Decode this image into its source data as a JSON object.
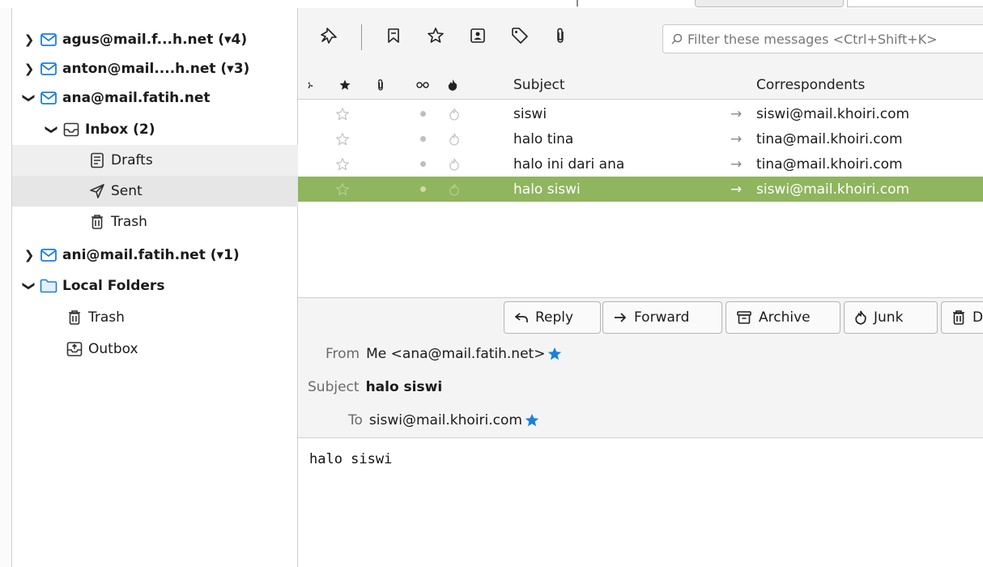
{
  "folders": {
    "acct1": {
      "label": "agus@mail.f...h.net (▾4)"
    },
    "acct2": {
      "label": "anton@mail....h.net (▾3)"
    },
    "acct3": {
      "label": "ana@mail.fatih.net"
    },
    "inbox": {
      "label": "Inbox (2)"
    },
    "drafts": {
      "label": "Drafts"
    },
    "sent": {
      "label": "Sent"
    },
    "trash": {
      "label": "Trash"
    },
    "acct4": {
      "label": "ani@mail.fatih.net (▾1)"
    },
    "local": {
      "label": "Local Folders"
    },
    "local_trash": {
      "label": "Trash"
    },
    "outbox": {
      "label": "Outbox"
    }
  },
  "filter": {
    "placeholder": "Filter these messages <Ctrl+Shift+K>"
  },
  "columns": {
    "subject": "Subject",
    "correspondents": "Correspondents"
  },
  "messages": [
    {
      "subject": "siswi",
      "correspondent": "siswi@mail.khoiri.com"
    },
    {
      "subject": "halo tina",
      "correspondent": "tina@mail.khoiri.com"
    },
    {
      "subject": "halo ini dari ana",
      "correspondent": "tina@mail.khoiri.com"
    },
    {
      "subject": "halo siswi",
      "correspondent": "siswi@mail.khoiri.com"
    }
  ],
  "arrow": "→",
  "actions": {
    "reply": "Reply",
    "forward": "Forward",
    "archive": "Archive",
    "junk": "Junk",
    "delete": "Delete"
  },
  "header": {
    "from_label": "From",
    "from_value": "Me <ana@mail.fatih.net>",
    "subject_label": "Subject",
    "subject_value": "halo siswi",
    "to_label": "To",
    "to_value": "siswi@mail.khoiri.com"
  },
  "body": {
    "text": "halo siswi"
  },
  "colors": {
    "selection": "#8fb55e",
    "accent_star": "#1a7fe0"
  }
}
